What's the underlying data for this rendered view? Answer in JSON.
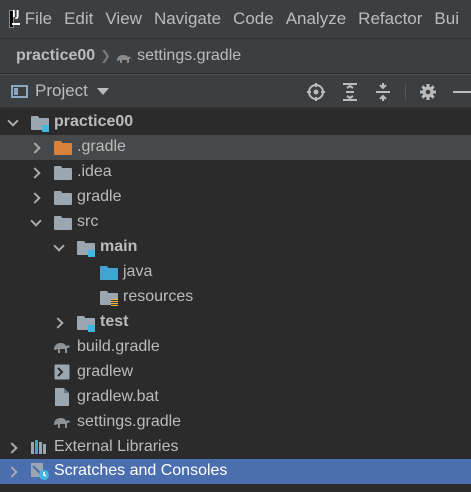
{
  "menu": {
    "items": [
      "File",
      "Edit",
      "View",
      "Navigate",
      "Code",
      "Analyze",
      "Refactor",
      "Bui"
    ]
  },
  "breadcrumb": {
    "project": "practice00",
    "file": "settings.gradle"
  },
  "tool_window": {
    "title": "Project",
    "buttons": [
      "locate-icon",
      "expand-all-icon",
      "collapse-all-icon",
      "gear-icon",
      "minimize-icon"
    ]
  },
  "tree": {
    "root": "practice00",
    "gradle_hidden": ".gradle",
    "idea": ".idea",
    "gradle": "gradle",
    "src": "src",
    "main": "main",
    "java": "java",
    "resources": "resources",
    "test": "test",
    "build_gradle": "build.gradle",
    "gradlew": "gradlew",
    "gradlew_bat": "gradlew.bat",
    "settings_gradle": "settings.gradle",
    "external_libraries": "External Libraries",
    "scratches": "Scratches and Consoles"
  },
  "colors": {
    "selection": "#4b6eaf",
    "folder_grey": "#9aa7b0",
    "folder_orange": "#d9823b",
    "source_root_blue": "#40a6d1"
  }
}
